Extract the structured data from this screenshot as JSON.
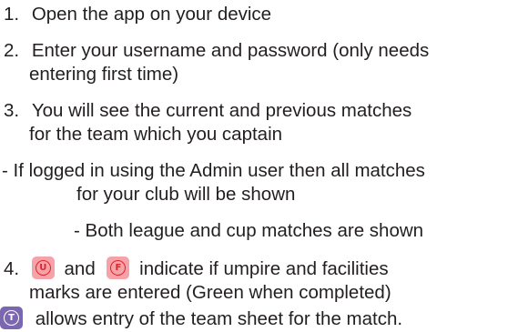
{
  "steps": [
    {
      "number": "1.",
      "text": "Open the app on your device"
    },
    {
      "number": "2.",
      "text": "Enter your username and password (only needs",
      "text2": "entering first time)"
    },
    {
      "number": "3.",
      "text": "You will see the current and previous matches",
      "text2": "for the team which you captain"
    }
  ],
  "notes": {
    "admin_line1": "- If logged in using the Admin user then all matches",
    "admin_line2": "for your club will be shown",
    "league_cup": "- Both league and cup matches are shown"
  },
  "step4": {
    "number": "4.",
    "and": "and",
    "text": "indicate if umpire and facilities",
    "text2": "marks are entered (Green when completed)"
  },
  "badges": {
    "umpire_letter": "U",
    "facilities_letter": "F",
    "team_letter": "T",
    "umpire_color": "#f5a3a8",
    "facilities_color": "#f5a3a8",
    "team_color": "#7b67b0"
  },
  "team_sheet_text": "allows entry of the team sheet for the match."
}
